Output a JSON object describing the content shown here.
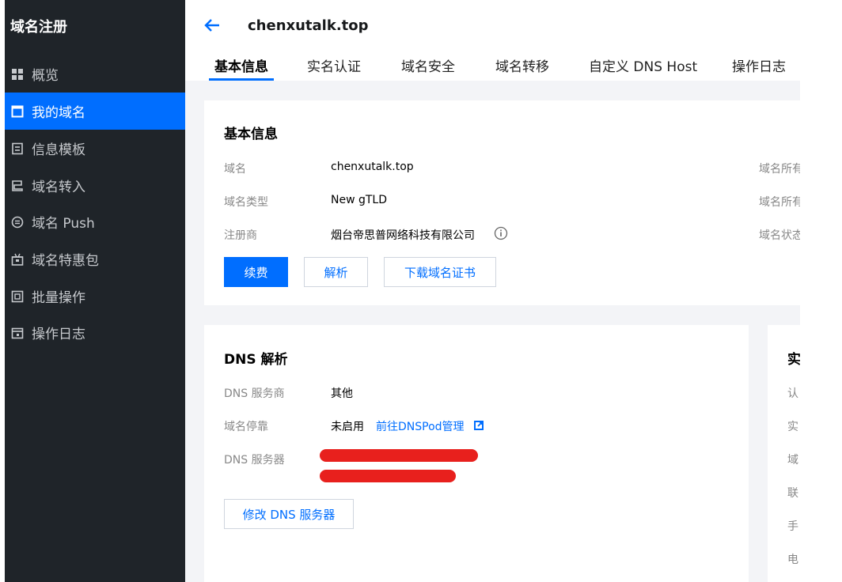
{
  "sidebar": {
    "title": "域名注册",
    "items": [
      {
        "label": "概览",
        "icon": "grid-icon"
      },
      {
        "label": "我的域名",
        "icon": "window-icon"
      },
      {
        "label": "信息模板",
        "icon": "document-icon"
      },
      {
        "label": "域名转入",
        "icon": "transfer-icon"
      },
      {
        "label": "域名 Push",
        "icon": "push-icon"
      },
      {
        "label": "域名特惠包",
        "icon": "gift-icon"
      },
      {
        "label": "批量操作",
        "icon": "batch-icon"
      },
      {
        "label": "操作日志",
        "icon": "calendar-icon"
      }
    ]
  },
  "header": {
    "domain": "chenxutalk.top",
    "tabs": [
      "基本信息",
      "实名认证",
      "域名安全",
      "域名转移",
      "自定义 DNS Host",
      "操作日志"
    ]
  },
  "basic": {
    "title": "基本信息",
    "rows": [
      {
        "label": "域名",
        "value": "chenxutalk.top"
      },
      {
        "label": "域名类型",
        "value": "New gTLD"
      },
      {
        "label": "注册商",
        "value": "烟台帝思普网络科技有限公司"
      }
    ],
    "right_labels": [
      "域名所有",
      "域名所有",
      "域名状态"
    ],
    "buttons": {
      "renew": "续费",
      "resolve": "解析",
      "download": "下载域名证书"
    }
  },
  "dns": {
    "title": "DNS 解析",
    "provider_label": "DNS 服务商",
    "provider_value": "其他",
    "parking_label": "域名停靠",
    "parking_value": "未启用",
    "parking_link": "前往DNSPod管理",
    "server_label": "DNS 服务器",
    "modify_button": "修改 DNS 服务器"
  },
  "realname": {
    "title": "实",
    "rows": [
      "认",
      "实",
      "域",
      "联",
      "手",
      "电"
    ]
  },
  "colors": {
    "accent": "#006eff",
    "sidebar_bg": "#1f2429",
    "redaction": "#e8201d"
  }
}
